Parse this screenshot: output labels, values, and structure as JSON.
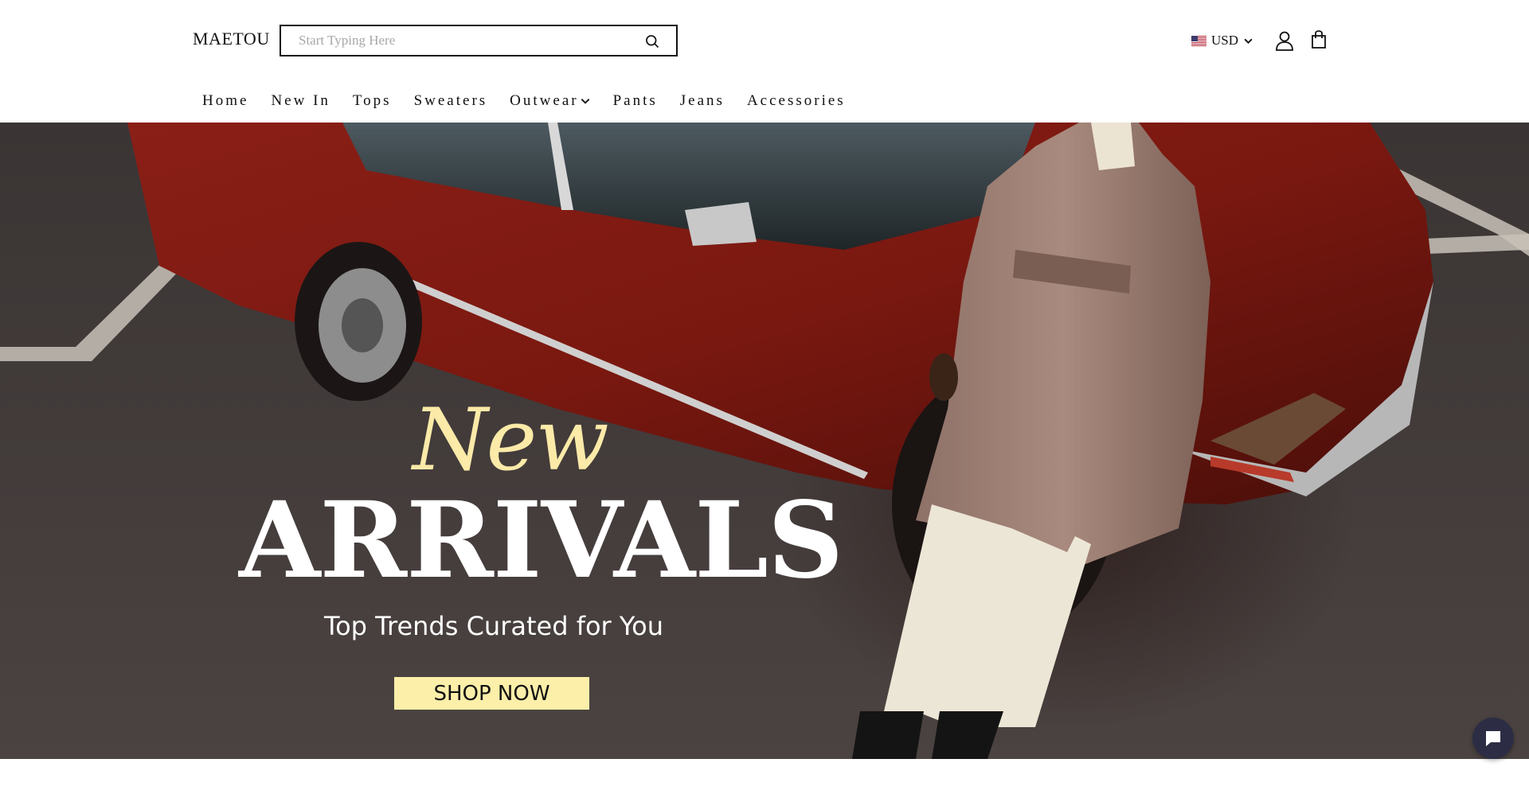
{
  "header": {
    "logo": "MAETOU",
    "search": {
      "placeholder": "Start Typing Here",
      "value": ""
    },
    "currency": "USD"
  },
  "nav": {
    "items": [
      {
        "label": "Home"
      },
      {
        "label": "New In"
      },
      {
        "label": "Tops"
      },
      {
        "label": "Sweaters"
      },
      {
        "label": "Outwear",
        "has_dropdown": true
      },
      {
        "label": "Pants"
      },
      {
        "label": "Jeans"
      },
      {
        "label": "Accessories"
      }
    ]
  },
  "hero": {
    "headline_script": "New",
    "headline_main": "ARRIVALS",
    "tagline": "Top Trends Curated for You",
    "cta_label": "SHOP NOW"
  },
  "colors": {
    "accent_yellow": "#fcefa9",
    "script_yellow": "#fbeaa8",
    "chat_button": "#2c2d44"
  },
  "icons": [
    "search-icon",
    "us-flag-icon",
    "chevron-down-icon",
    "account-icon",
    "shopping-bag-icon",
    "chat-icon"
  ]
}
